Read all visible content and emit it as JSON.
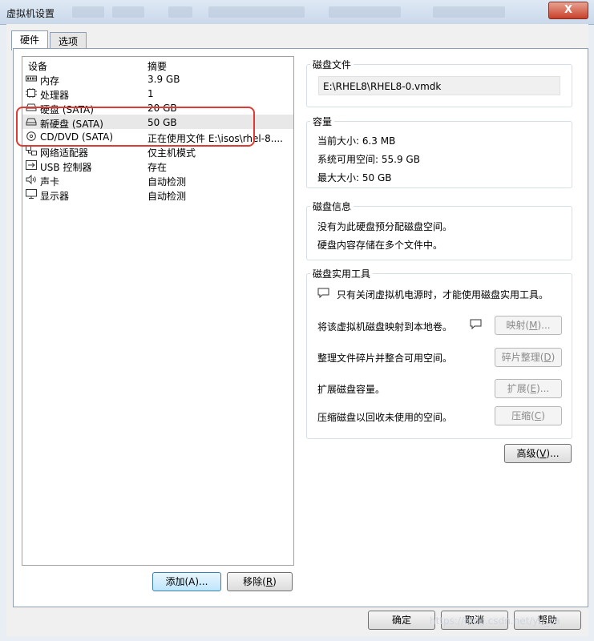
{
  "window": {
    "title": "虚拟机设置",
    "close_label": "X"
  },
  "tabs": [
    {
      "label": "硬件"
    },
    {
      "label": "选项"
    }
  ],
  "device_list": {
    "headers": {
      "device": "设备",
      "summary": "摘要"
    },
    "rows": [
      {
        "name": "内存",
        "summary": "3.9 GB",
        "icon": "memory-icon"
      },
      {
        "name": "处理器",
        "summary": "1",
        "icon": "cpu-icon"
      },
      {
        "name": "硬盘 (SATA)",
        "summary": "20 GB",
        "icon": "hard-disk-icon"
      },
      {
        "name": "新硬盘 (SATA)",
        "summary": "50 GB",
        "icon": "hard-disk-icon",
        "selected": true
      },
      {
        "name": "CD/DVD (SATA)",
        "summary": "正在使用文件 E:\\isos\\rhel-8....",
        "icon": "cd-dvd-icon"
      },
      {
        "name": "网络适配器",
        "summary": "仅主机模式",
        "icon": "network-icon"
      },
      {
        "name": "USB 控制器",
        "summary": "存在",
        "icon": "usb-icon"
      },
      {
        "name": "声卡",
        "summary": "自动检测",
        "icon": "sound-icon"
      },
      {
        "name": "显示器",
        "summary": "自动检测",
        "icon": "monitor-icon"
      }
    ]
  },
  "list_buttons": {
    "add": "添加(A)...",
    "remove_prefix": "移除(",
    "remove_key": "R",
    "remove_suffix": ")"
  },
  "disk_file": {
    "label": "磁盘文件",
    "path": "E:\\RHEL8\\RHEL8-0.vmdk"
  },
  "capacity": {
    "label": "容量",
    "current": "当前大小: 6.3 MB",
    "available": "系统可用空间: 55.9 GB",
    "max": "最大大小: 50 GB"
  },
  "disk_info": {
    "label": "磁盘信息",
    "line1": "没有为此硬盘预分配磁盘空间。",
    "line2": "硬盘内容存储在多个文件中。"
  },
  "utilities": {
    "label": "磁盘实用工具",
    "note": "只有关闭虚拟机电源时，才能使用磁盘实用工具。",
    "map_text": "将该虚拟机磁盘映射到本地卷。",
    "map_button": {
      "prefix": "映射(",
      "key": "M",
      "suffix": ")..."
    },
    "defrag_text": "整理文件碎片并整合可用空间。",
    "defrag_button": {
      "prefix": "碎片整理(",
      "key": "D",
      "suffix": ")"
    },
    "expand_text": "扩展磁盘容量。",
    "expand_button": {
      "prefix": "扩展(",
      "key": "E",
      "suffix": ")..."
    },
    "compact_text": "压缩磁盘以回收未使用的空间。",
    "compact_button": {
      "prefix": "压缩(",
      "key": "C",
      "suffix": ")"
    }
  },
  "advanced_button": {
    "prefix": "高级(",
    "key": "V",
    "suffix": ")..."
  },
  "footer": {
    "ok": "确定",
    "cancel": "取消",
    "help": "帮助"
  },
  "watermark": "https://blog.csdn.net/yu_ca"
}
